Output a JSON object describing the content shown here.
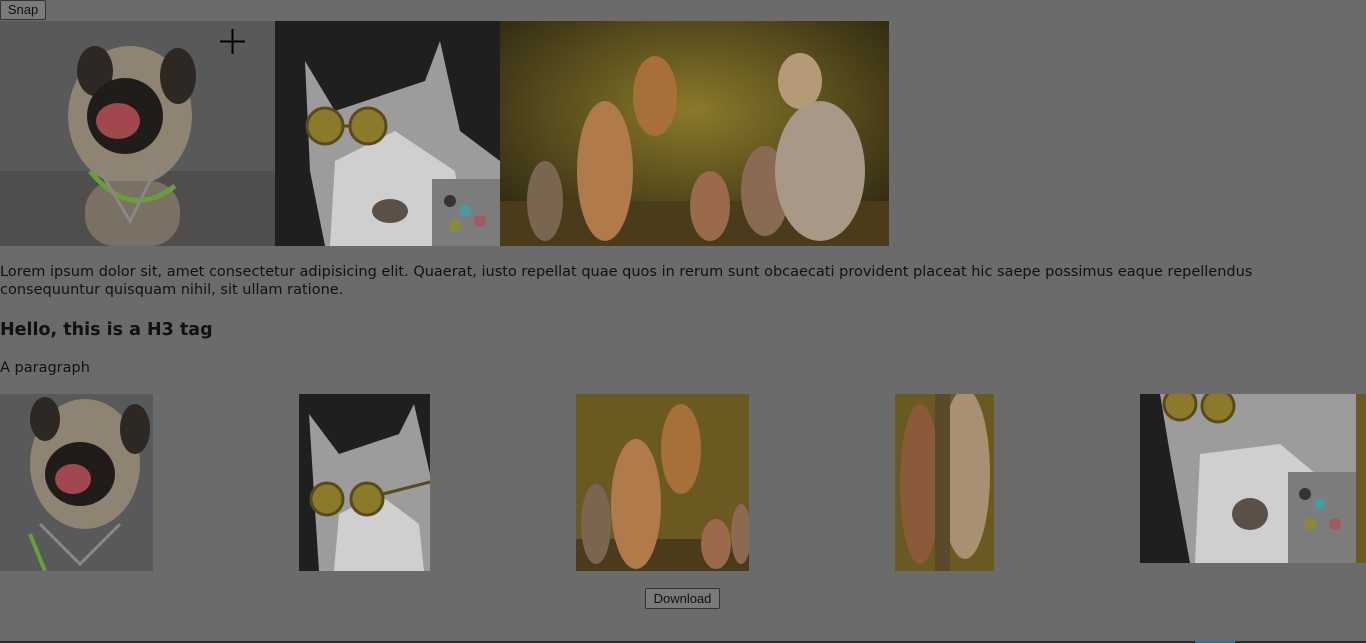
{
  "toolbar": {
    "snap_label": "Snap"
  },
  "text": {
    "lorem": "Lorem ipsum dolor sit, amet consectetur adipisicing elit. Quaerat, iusto repellat quae quos in rerum sunt obcaecati provident placeat hic saepe possimus eaque repellendus consequuntur quisquam nihil, sit ullam ratione.",
    "heading": "Hello, this is a H3 tag",
    "paragraph": "A paragraph"
  },
  "footer": {
    "download_label": "Download"
  },
  "images": {
    "top": [
      "pug-photo",
      "cat-with-sunglasses-photo",
      "cats-and-dogs-group-photo"
    ],
    "bottom": [
      "pug-photo-crop",
      "cat-with-sunglasses-crop",
      "cats-group-crop",
      "dogs-group-crop",
      "cat-with-sunglasses-crop-2"
    ]
  },
  "colors": {
    "overlay_bg": "#6b6b6b"
  }
}
